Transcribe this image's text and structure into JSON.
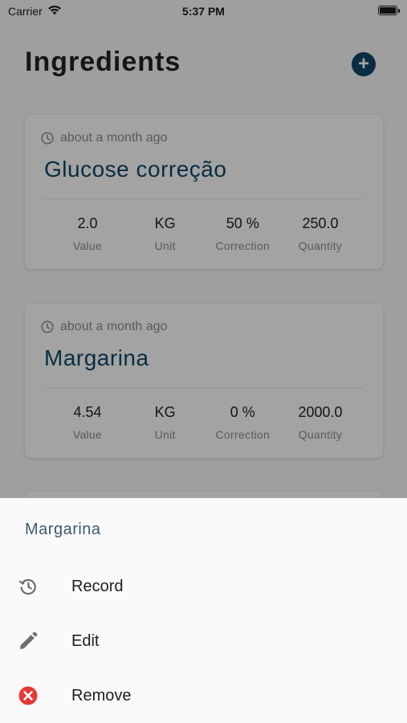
{
  "status_bar": {
    "carrier": "Carrier",
    "time": "5:37 PM"
  },
  "header": {
    "title": "Ingredients",
    "add_icon": "plus-circle-icon"
  },
  "cards": [
    {
      "time": "about a month ago",
      "name": "Glucose correção",
      "stats": [
        {
          "value": "2.0",
          "label": "Value"
        },
        {
          "value": "KG",
          "label": "Unit"
        },
        {
          "value": "50 %",
          "label": "Correction"
        },
        {
          "value": "250.0",
          "label": "Quantity"
        }
      ]
    },
    {
      "time": "about a month ago",
      "name": "Margarina",
      "stats": [
        {
          "value": "4.54",
          "label": "Value"
        },
        {
          "value": "KG",
          "label": "Unit"
        },
        {
          "value": "0 %",
          "label": "Correction"
        },
        {
          "value": "2000.0",
          "label": "Quantity"
        }
      ]
    }
  ],
  "sheet": {
    "title": "Margarina",
    "items": [
      {
        "label": "Record",
        "icon": "history-icon"
      },
      {
        "label": "Edit",
        "icon": "pencil-icon"
      },
      {
        "label": "Remove",
        "icon": "remove-circle-icon"
      }
    ]
  },
  "colors": {
    "accent": "#0e4564",
    "danger": "#e53935",
    "muted": "#8a8a8a"
  }
}
